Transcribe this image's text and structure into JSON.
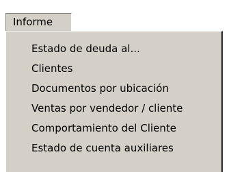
{
  "menubar": {
    "label": "Informe"
  },
  "menu": {
    "items": [
      {
        "label": "Estado de deuda al..."
      },
      {
        "label": "Clientes"
      },
      {
        "label": "Documentos por ubicación"
      },
      {
        "label": "Ventas por vendedor / cliente"
      },
      {
        "label": "Comportamiento del Cliente"
      },
      {
        "label": "Estado de cuenta auxiliares"
      }
    ]
  }
}
